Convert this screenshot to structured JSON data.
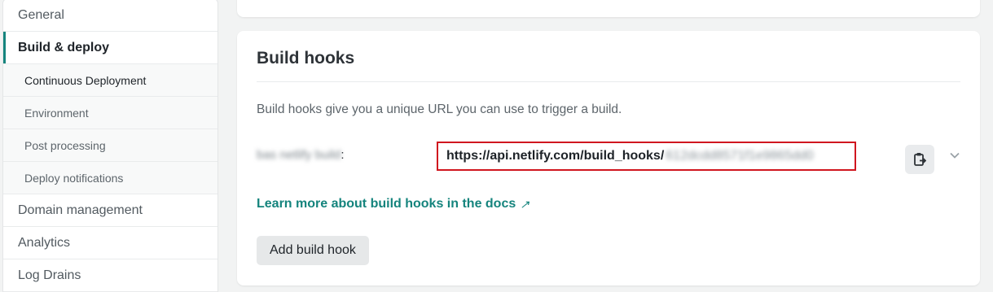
{
  "sidebar": {
    "items": [
      {
        "label": "General"
      },
      {
        "label": "Build & deploy"
      },
      {
        "label": "Continuous Deployment"
      },
      {
        "label": "Environment"
      },
      {
        "label": "Post processing"
      },
      {
        "label": "Deploy notifications"
      },
      {
        "label": "Domain management"
      },
      {
        "label": "Analytics"
      },
      {
        "label": "Log Drains"
      }
    ]
  },
  "build_hooks": {
    "title": "Build hooks",
    "description": "Build hooks give you a unique URL you can use to trigger a build.",
    "hook": {
      "name_redacted": "bas netlify build",
      "name_suffix": ":",
      "url_prefix": "https://api.netlify.com/build_hooks/",
      "url_token_redacted": "612dcdd8571f1e9865dd0"
    },
    "docs_link": "Learn more about build hooks in the docs",
    "docs_link_icon": "↗",
    "add_button": "Add build hook"
  },
  "colors": {
    "accent": "#15847d",
    "highlight_border": "#d0161f"
  },
  "icons": {
    "copy": "clipboard-copy-icon",
    "expand": "chevron-down-icon",
    "external": "external-link-arrow-icon"
  }
}
